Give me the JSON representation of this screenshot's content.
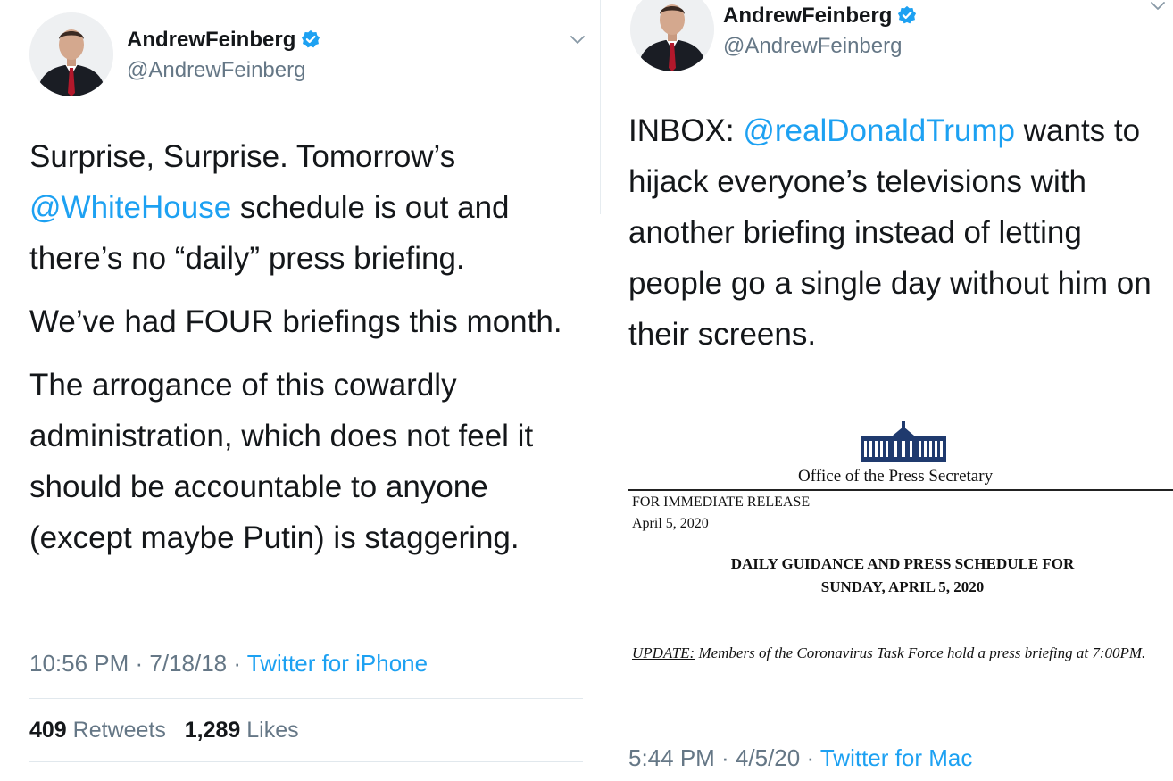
{
  "left_tweet": {
    "author_name": "AndrewFeinberg",
    "author_handle": "@AndrewFeinberg",
    "para1_text1": "Surprise, Surprise. Tomorrow’s",
    "para1_mention": "@WhiteHouse",
    "para1_text2": "schedule is out and there’s no “daily” press briefing.",
    "para2": "We’ve had FOUR briefings this month.",
    "para3": "The arrogance of this cowardly administration, which does not feel it should be accountable to anyone (except maybe Putin) is staggering.",
    "timestamp": "10:56 PM · 7/18/18 · ",
    "source": "Twitter for iPhone",
    "retweets_count": "409",
    "retweets_label": "Retweets",
    "likes_count": "1,289",
    "likes_label": "Likes"
  },
  "right_tweet": {
    "author_name": "AndrewFeinberg",
    "author_handle": "@AndrewFeinberg",
    "text_prefix": "INBOX:",
    "mention": "@realDonaldTrump",
    "text_rest": "wants to hijack everyone’s televisions with another briefing instead of letting people go a single day without him on their screens.",
    "timestamp": "5:44 PM · 4/5/20 · ",
    "source": "Twitter for Mac"
  },
  "press_release": {
    "office": "Office of the Press Secretary",
    "release_type": "FOR IMMEDIATE RELEASE",
    "date": "April 5, 2020",
    "title_line1": "DAILY GUIDANCE AND PRESS SCHEDULE FOR",
    "title_line2": "SUNDAY, APRIL 5, 2020",
    "update_label": "UPDATE:",
    "update_text": "Members of the Coronavirus Task Force hold a press briefing at 7:00PM."
  },
  "colors": {
    "link": "#1da1f2",
    "secondary_text": "#657786",
    "primary_text": "#14171a"
  },
  "icons": [
    "verified-badge-icon",
    "chevron-down-icon",
    "white-house-logo-icon"
  ]
}
